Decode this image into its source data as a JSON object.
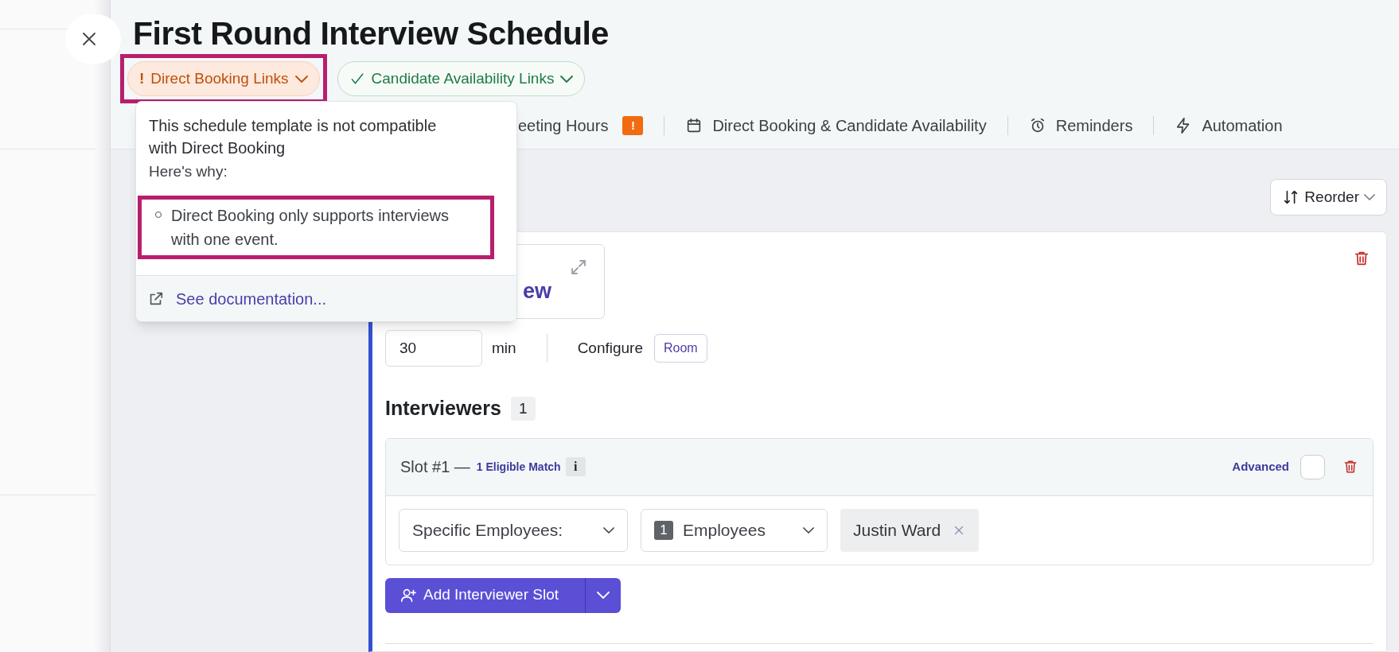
{
  "title": "First Round Interview Schedule",
  "status_badges": [
    {
      "kind": "warning",
      "mark": "!",
      "label": "Direct Booking Links",
      "highlighted": true
    },
    {
      "kind": "ok",
      "label": "Candidate Availability Links",
      "highlighted": false
    }
  ],
  "tabs": [
    {
      "label": "eeting Hours",
      "kind": "plain",
      "alert": "!",
      "selected": false
    },
    {
      "label": "Direct Booking & Candidate Availability",
      "kind": "calendar",
      "selected": false
    },
    {
      "label": "Reminders",
      "kind": "alarm",
      "selected": false
    },
    {
      "label": "Automation",
      "kind": "bolt",
      "selected": false
    }
  ],
  "popover": {
    "message": "This schedule template is not compatible with Direct Booking",
    "lead": "Here's why:",
    "reasons": [
      {
        "text": "Direct Booking only supports interviews with one event.",
        "highlighted": true
      }
    ],
    "link": "See documentation..."
  },
  "reorder_button": "Reorder",
  "event": {
    "name": "ew",
    "duration": "30",
    "unit": "min",
    "configure_label": "Configure",
    "configure_chips": [
      "Room"
    ],
    "interviewers_heading": "Interviewers",
    "interviewer_count": "1",
    "slots": [
      {
        "title": "Slot #1 —",
        "match": "1 Eligible Match",
        "info": "i",
        "advanced_label": "Advanced",
        "advanced_checked": false,
        "type_select": "Specific Employees:",
        "count": "1",
        "count_label": "Employees",
        "people": [
          "Justin Ward"
        ]
      }
    ],
    "add_button": "Add Interviewer Slot"
  }
}
